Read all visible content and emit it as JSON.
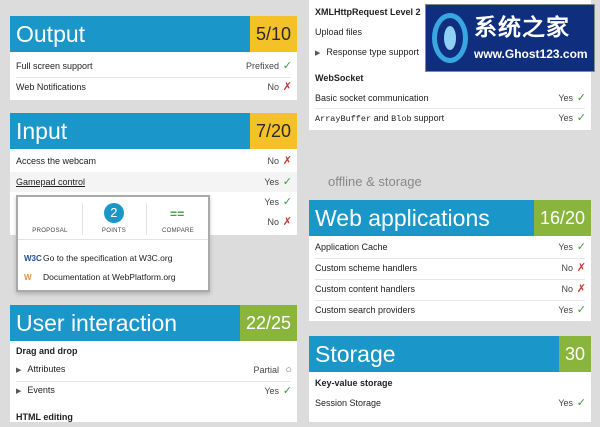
{
  "output": {
    "title": "Output",
    "score": "5/10",
    "rows": [
      {
        "label": "Full screen support",
        "value": "Prefixed",
        "mark": "✓"
      },
      {
        "label": "Web Notifications",
        "value": "No",
        "mark": "✗"
      }
    ]
  },
  "input": {
    "title": "Input",
    "score": "7/20",
    "rows": [
      {
        "label": "Access the webcam",
        "value": "No",
        "mark": "✗"
      },
      {
        "label": "Gamepad control",
        "value": "Yes",
        "mark": "✓"
      },
      {
        "label": "",
        "value": "Yes",
        "mark": "✓"
      },
      {
        "label": "",
        "value": "No",
        "mark": "✗"
      }
    ]
  },
  "popup": {
    "tab_proposal": "PROPOSAL",
    "points_value": "2",
    "tab_points": "POINTS",
    "tab_compare": "COMPARE",
    "compare_glyph": "==",
    "w3c_icon": "W3C",
    "wp_icon": "W",
    "link_w3c": "Go to the specification at W3C.org",
    "link_wp": "Documentation at WebPlatform.org"
  },
  "user_interaction": {
    "title": "User interaction",
    "score": "22/25",
    "section_drag": "Drag and drop",
    "rows": [
      {
        "label": "Attributes",
        "value": "Partial",
        "mark": "○"
      },
      {
        "label": "Events",
        "value": "Yes",
        "mark": "✓"
      }
    ],
    "section_html": "HTML editing"
  },
  "right_top": {
    "section_xhr": "XMLHttpRequest Level 2",
    "upload": "Upload files",
    "response_type": "Response type support",
    "section_ws": "WebSocket",
    "ws_rows": [
      {
        "label_a": "Basic socket communication",
        "label_b": "",
        "label_c": "",
        "value": "Yes",
        "mark": "✓"
      },
      {
        "label_a": "ArrayBuffer",
        "label_b": " and ",
        "label_c": "Blob",
        "label_d": " support",
        "value": "Yes",
        "mark": "✓"
      }
    ]
  },
  "offline_title": "offline & storage",
  "web_applications": {
    "title": "Web applications",
    "score": "16/20",
    "rows": [
      {
        "label": "Application Cache",
        "value": "Yes",
        "mark": "✓"
      },
      {
        "label": "Custom scheme handlers",
        "value": "No",
        "mark": "✗"
      },
      {
        "label": "Custom content handlers",
        "value": "No",
        "mark": "✗"
      },
      {
        "label": "Custom search providers",
        "value": "Yes",
        "mark": "✓"
      }
    ]
  },
  "storage": {
    "title": "Storage",
    "score": "30",
    "section_kv": "Key-value storage",
    "rows": [
      {
        "label": "Session Storage",
        "value": "Yes",
        "mark": "✓"
      }
    ]
  },
  "logo": {
    "text_cn": "系统之家",
    "url": "www.Ghost123.com"
  },
  "colors": {
    "header_blue": "#1a96c8",
    "score_yellow": "#f4c129",
    "score_green": "#8ab53d",
    "yes_green": "#3a9c3a",
    "no_red": "#c0392b"
  }
}
